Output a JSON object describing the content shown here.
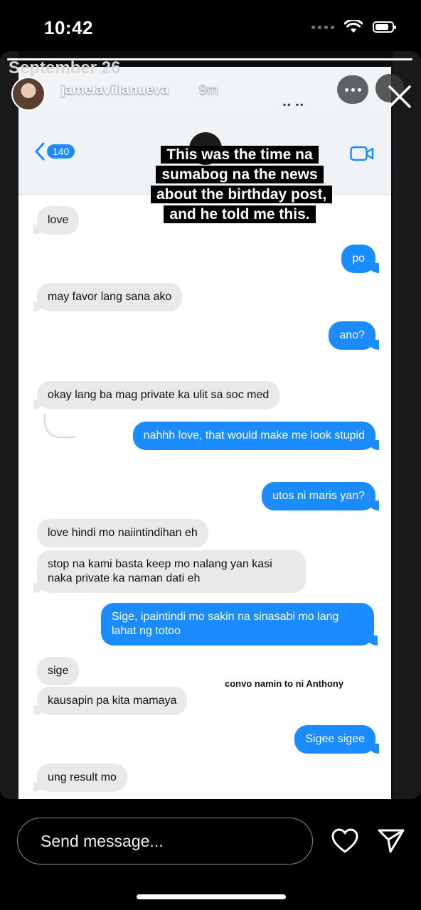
{
  "status_bar": {
    "time": "10:42"
  },
  "story": {
    "progress": 1.0,
    "username": "jamelavillanueva",
    "age": "9m",
    "date_label": "September 26"
  },
  "screenshot": {
    "unread_count": "140",
    "caption": "This was the time na sumabog na the news about the birthday post, and he told me this.",
    "note": "convo namin to ni Anthony",
    "accent_color": "#1a8cff",
    "messages": [
      {
        "dir": "in",
        "text": "love"
      },
      {
        "dir": "out",
        "text": "po"
      },
      {
        "dir": "in",
        "text": "may favor lang sana ako"
      },
      {
        "dir": "out",
        "text": "ano?"
      },
      {
        "dir": "in",
        "text": "okay lang ba mag private ka ulit sa soc med"
      },
      {
        "dir": "out",
        "text": "nahhh love, that would make me look stupid"
      },
      {
        "dir": "out",
        "text": "utos ni maris yan?"
      },
      {
        "dir": "in",
        "text": "love hindi mo naiintindihan eh"
      },
      {
        "dir": "in",
        "text": "stop na kami basta keep mo nalang yan kasi naka private ka naman dati eh"
      },
      {
        "dir": "out",
        "text": "Sige, ipaintindi mo sakin na sinasabi mo lang lahat ng totoo"
      },
      {
        "dir": "in",
        "text": "sige"
      },
      {
        "dir": "in",
        "text": "kausapin pa kita mamaya"
      },
      {
        "dir": "out",
        "text": "Sigee sigee"
      },
      {
        "dir": "in",
        "text": "ung result mo"
      }
    ]
  },
  "reply_bar": {
    "placeholder": "Send message...",
    "icons": [
      "heart-icon",
      "send-icon"
    ]
  }
}
